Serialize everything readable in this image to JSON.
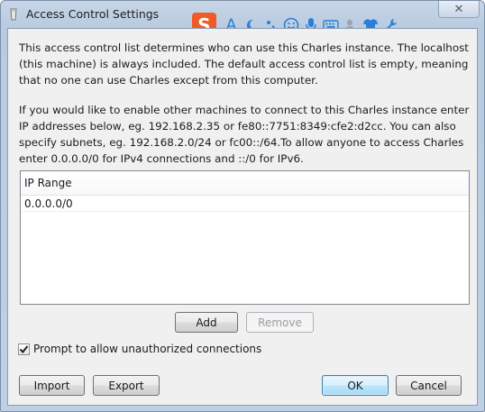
{
  "window": {
    "title": "Access Control Settings",
    "close_label": "✕"
  },
  "ime_toolbar": {
    "logo": "S",
    "icons": [
      "letter-a-icon",
      "moon-icon",
      "punctuation-icon",
      "smiley-icon",
      "microphone-icon",
      "keyboard-icon",
      "user-icon",
      "shirt-icon",
      "wrench-icon"
    ],
    "letter": "A"
  },
  "description": {
    "paragraph1": "This access control list determines who can use this Charles instance. The localhost (this machine) is always included. The default access control list is empty, meaning that no one can use Charles except from this computer.",
    "paragraph2": "If you would like to enable other machines to connect to this Charles instance enter IP addresses below, eg. 192.168.2.35 or fe80::7751:8349:cfe2:d2cc. You can also specify subnets, eg. 192.168.2.0/24 or fc00::/64.To allow anyone to access Charles enter 0.0.0.0/0 for IPv4 connections and ::/0 for IPv6."
  },
  "table": {
    "header": "IP Range",
    "rows": [
      "0.0.0.0/0"
    ]
  },
  "buttons": {
    "add": "Add",
    "remove": "Remove",
    "import": "Import",
    "export": "Export",
    "ok": "OK",
    "cancel": "Cancel"
  },
  "prompt_checkbox": {
    "label": "Prompt to allow unauthorized connections",
    "checked": true
  },
  "colors": {
    "ime_brand": "#f15a24",
    "ime_icon": "#2a7fd6",
    "default_button_border": "#3c7fb1"
  }
}
